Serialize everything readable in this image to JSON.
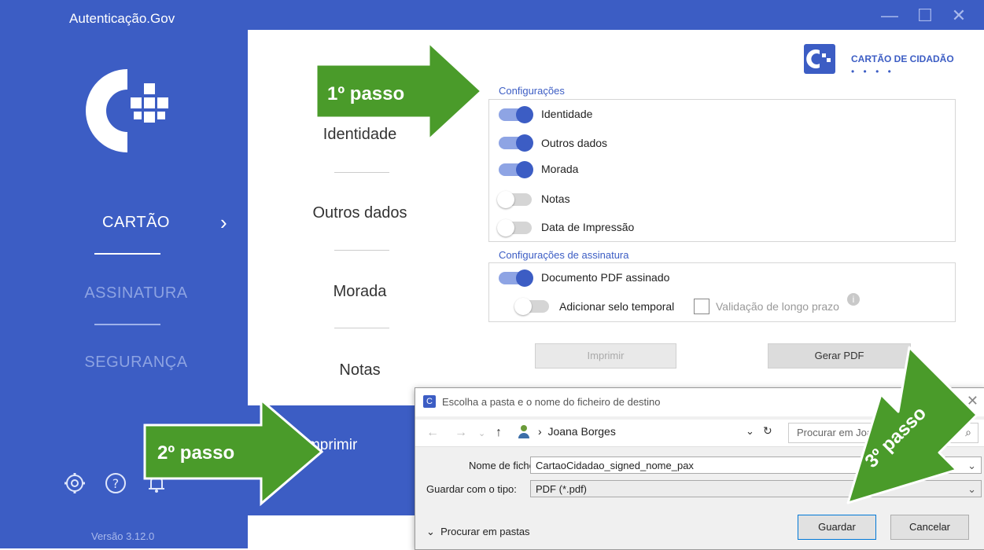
{
  "app": {
    "title": "Autenticação.Gov",
    "version": "Versão 3.12.0"
  },
  "sidebar": {
    "items": [
      {
        "label": "CARTÃO",
        "active": true
      },
      {
        "label": "ASSINATURA",
        "active": false
      },
      {
        "label": "SEGURANÇA",
        "active": false
      }
    ],
    "bottom_icons": [
      "gear-icon",
      "help-icon",
      "bell-icon"
    ]
  },
  "window_controls": [
    "minimize-icon",
    "maximize-icon",
    "close-icon"
  ],
  "tabs": [
    {
      "label": "Identidade"
    },
    {
      "label": "Outros dados"
    },
    {
      "label": "Morada"
    },
    {
      "label": "Notas"
    },
    {
      "label": "Imprimir",
      "active": true
    }
  ],
  "brand": {
    "text": "CARTÃO DE CIDADÃO",
    "dots": "• • • •"
  },
  "config": {
    "title": "Configurações",
    "options": [
      {
        "label": "Identidade",
        "on": true
      },
      {
        "label": "Outros dados",
        "on": true
      },
      {
        "label": "Morada",
        "on": true
      },
      {
        "label": "Notas",
        "on": false
      },
      {
        "label": "Data de Impressão",
        "on": false
      }
    ]
  },
  "signature": {
    "title": "Configurações de assinatura",
    "signed_pdf": {
      "label": "Documento PDF assinado",
      "on": true
    },
    "timestamp": {
      "label": "Adicionar selo temporal",
      "on": false
    },
    "long_term": {
      "label": "Validação de longo prazo",
      "checked": false
    }
  },
  "buttons": {
    "print": "Imprimir",
    "pdf": "Gerar PDF"
  },
  "dialog": {
    "title": "Escolha a pasta e o nome do ficheiro de destino",
    "path": "Joana Borges",
    "search_placeholder": "Procurar em Joana Borges",
    "filename_label": "Nome de ficheiro:",
    "filename": "CartaoCidadao_signed_nome_pax",
    "type_label": "Guardar com o tipo:",
    "type": "PDF (*.pdf)",
    "browse": "Procurar em pastas",
    "save": "Guardar",
    "cancel": "Cancelar"
  },
  "annotations": {
    "step1": "1º passo",
    "step2": "2º passo",
    "step3": "3º passo",
    "arrow_color": "#4a9b2a"
  }
}
